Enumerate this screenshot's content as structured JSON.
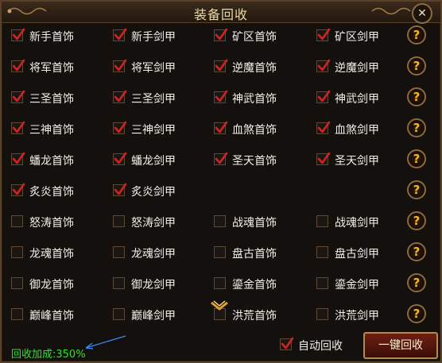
{
  "title": "装备回收",
  "colors": {
    "bonus_text": "#2fe02f",
    "check_mark": "#d22323",
    "help_icon": "#f6b615"
  },
  "rows": [
    {
      "items": [
        {
          "label": "新手首饰",
          "checked": true
        },
        {
          "label": "新手剑甲",
          "checked": true
        },
        {
          "label": "矿区首饰",
          "checked": true
        },
        {
          "label": "矿区剑甲",
          "checked": true
        }
      ]
    },
    {
      "items": [
        {
          "label": "将军首饰",
          "checked": true
        },
        {
          "label": "将军剑甲",
          "checked": true
        },
        {
          "label": "逆魔首饰",
          "checked": true
        },
        {
          "label": "逆魔剑甲",
          "checked": true
        }
      ]
    },
    {
      "items": [
        {
          "label": "三圣首饰",
          "checked": true
        },
        {
          "label": "三圣剑甲",
          "checked": true
        },
        {
          "label": "神武首饰",
          "checked": true
        },
        {
          "label": "神武剑甲",
          "checked": true
        }
      ]
    },
    {
      "items": [
        {
          "label": "三神首饰",
          "checked": true
        },
        {
          "label": "三神剑甲",
          "checked": true
        },
        {
          "label": "血煞首饰",
          "checked": true
        },
        {
          "label": "血煞剑甲",
          "checked": true
        }
      ]
    },
    {
      "items": [
        {
          "label": "蟠龙首饰",
          "checked": true
        },
        {
          "label": "蟠龙剑甲",
          "checked": true
        },
        {
          "label": "圣天首饰",
          "checked": true
        },
        {
          "label": "圣天剑甲",
          "checked": true
        }
      ]
    },
    {
      "items": [
        {
          "label": "炙炎首饰",
          "checked": true
        },
        {
          "label": "炙炎剑甲",
          "checked": true
        }
      ]
    },
    {
      "items": [
        {
          "label": "怒涛首饰",
          "checked": false
        },
        {
          "label": "怒涛剑甲",
          "checked": false
        },
        {
          "label": "战魂首饰",
          "checked": false
        },
        {
          "label": "战魂剑甲",
          "checked": false
        }
      ]
    },
    {
      "items": [
        {
          "label": "龙魂首饰",
          "checked": false
        },
        {
          "label": "龙魂剑甲",
          "checked": false
        },
        {
          "label": "盘古首饰",
          "checked": false
        },
        {
          "label": "盘古剑甲",
          "checked": false
        }
      ]
    },
    {
      "items": [
        {
          "label": "御龙首饰",
          "checked": false
        },
        {
          "label": "御龙剑甲",
          "checked": false
        },
        {
          "label": "鎏金首饰",
          "checked": false
        },
        {
          "label": "鎏金剑甲",
          "checked": false
        }
      ]
    },
    {
      "items": [
        {
          "label": "巅峰首饰",
          "checked": false
        },
        {
          "label": "巅峰剑甲",
          "checked": false
        },
        {
          "label": "洪荒首饰",
          "checked": false
        },
        {
          "label": "洪荒剑甲",
          "checked": false
        }
      ]
    }
  ],
  "help_label": "?",
  "bonus_text": "回收加成:350%",
  "auto_recycle": {
    "label": "自动回收",
    "checked": true
  },
  "recycle_button": "一键回收",
  "close_label": "✕"
}
